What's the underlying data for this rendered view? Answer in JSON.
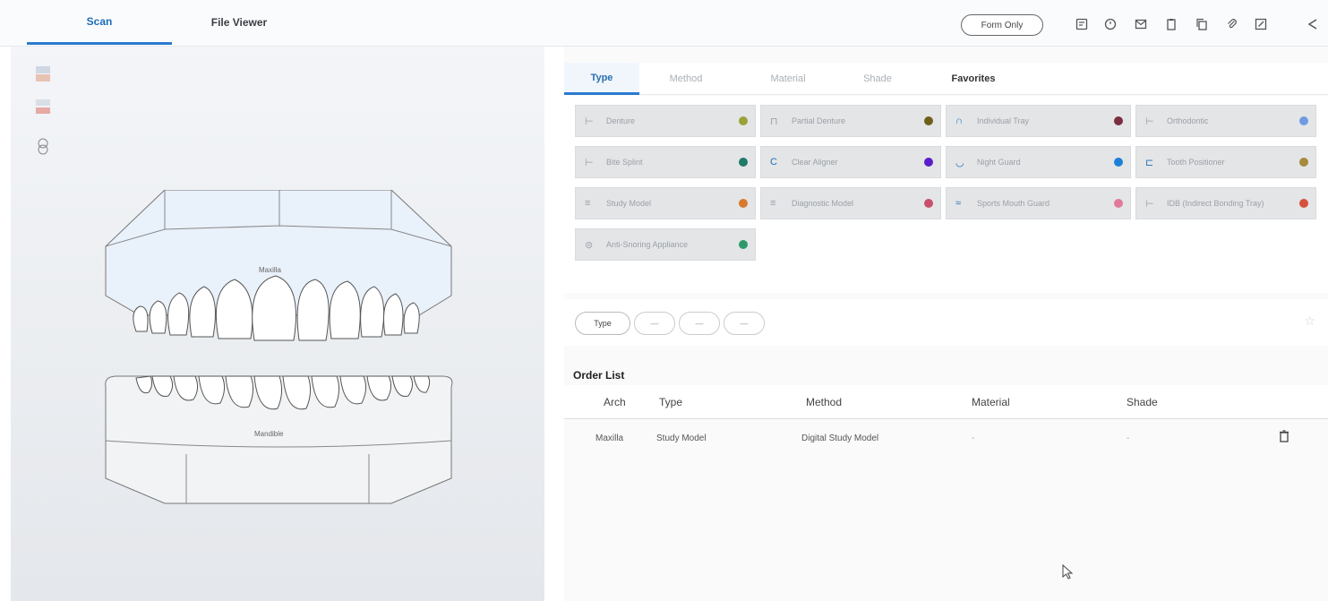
{
  "tabs": {
    "scan": "Scan",
    "file_viewer": "File Viewer"
  },
  "toolbar": {
    "form_only": "Form Only",
    "tools": [
      "form-icon",
      "history-icon",
      "mail-icon",
      "clipboard-icon",
      "copy-icon",
      "attach-icon",
      "edit-icon",
      "share-icon"
    ]
  },
  "jaw": {
    "maxilla": "Maxilla",
    "mandible": "Mandible"
  },
  "subtabs": {
    "type": "Type",
    "method": "Method",
    "material": "Material",
    "shade": "Shade",
    "favorites": "Favorites"
  },
  "types": [
    {
      "label": "Denture",
      "color": "#9aa23a"
    },
    {
      "label": "Partial Denture",
      "color": "#6f5f1a"
    },
    {
      "label": "Individual Tray",
      "color": "#7a2e3f"
    },
    {
      "label": "Orthodontic",
      "color": "#6f9be2"
    },
    {
      "label": "Bite Splint",
      "color": "#1f7a6a"
    },
    {
      "label": "Clear Aligner",
      "color": "#5a1fc9"
    },
    {
      "label": "Night Guard",
      "color": "#1e7fd6"
    },
    {
      "label": "Tooth Positioner",
      "color": "#a48a3c"
    },
    {
      "label": "Study Model",
      "color": "#d67a2e"
    },
    {
      "label": "Diagnostic Model",
      "color": "#c8506e"
    },
    {
      "label": "Sports Mouth Guard",
      "color": "#e07a98"
    },
    {
      "label": "IDB (Indirect Bonding Tray)",
      "color": "#d6503e"
    },
    {
      "label": "Anti-Snoring Appliance",
      "color": "#2e9a6a"
    }
  ],
  "filter": {
    "type_pill": "Type",
    "pill2": "—",
    "pill3": "—",
    "pill4": "—"
  },
  "order": {
    "title": "Order List",
    "headers": {
      "arch": "Arch",
      "type": "Type",
      "method": "Method",
      "material": "Material",
      "shade": "Shade"
    },
    "rows": [
      {
        "arch": "Maxilla",
        "type": "Study Model",
        "method": "Digital Study Model",
        "material": "-",
        "shade": "-"
      }
    ]
  }
}
